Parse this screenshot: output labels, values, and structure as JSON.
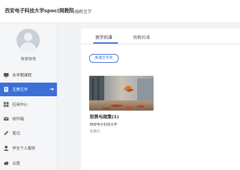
{
  "header": {
    "brand": "西安电子科技大学spoc(网教院...",
    "crumb": "互教互学"
  },
  "sidebar": {
    "user_name": "彼彼彼彼",
    "items": [
      {
        "label": "本学期课程",
        "icon": "screen-icon"
      },
      {
        "label": "互教互学",
        "icon": "book-icon",
        "active": true
      },
      {
        "label": "应用中心",
        "icon": "apps-icon"
      },
      {
        "label": "收件箱",
        "icon": "mail-icon"
      },
      {
        "label": "笔记",
        "icon": "note-icon"
      },
      {
        "label": "学生个人服务",
        "icon": "user-icon"
      },
      {
        "label": "云盘",
        "icon": "cloud-icon"
      }
    ],
    "arrow": "➜"
  },
  "content": {
    "tabs": [
      {
        "label": "我学的课",
        "active": true
      },
      {
        "label": "我教的课"
      }
    ],
    "new_folder_label": "新建文件夹",
    "course": {
      "title": "形势与政策(1)",
      "school": "西安电子科技大学",
      "teacher": "彭丽凡"
    }
  },
  "colors": {
    "accent": "#3d6fd9",
    "background": "#f2f3f5"
  }
}
